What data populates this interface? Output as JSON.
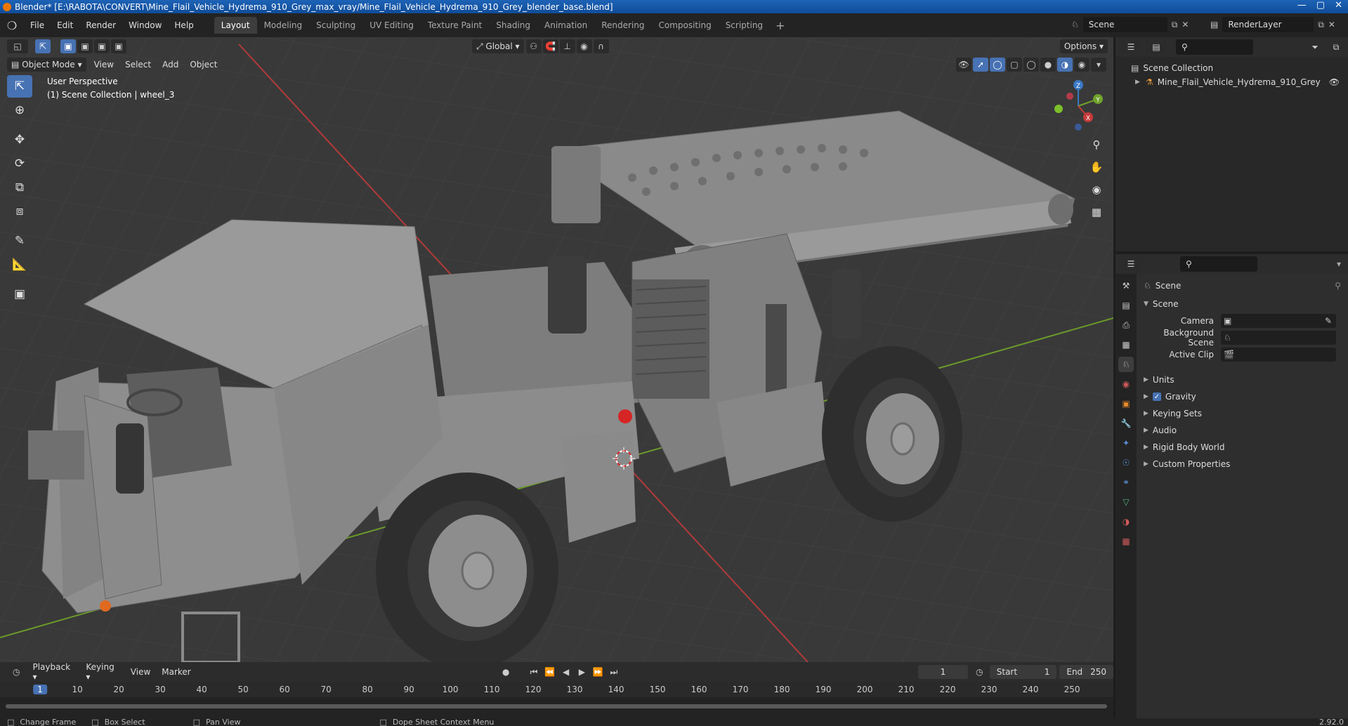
{
  "window": {
    "title": "Blender* [E:\\RABOTA\\CONVERT\\Mine_Flail_Vehicle_Hydrema_910_Grey_max_vray/Mine_Flail_Vehicle_Hydrema_910_Grey_blender_base.blend]"
  },
  "menu": [
    "File",
    "Edit",
    "Render",
    "Window",
    "Help"
  ],
  "workspaces": [
    "Layout",
    "Modeling",
    "Sculpting",
    "UV Editing",
    "Texture Paint",
    "Shading",
    "Animation",
    "Rendering",
    "Compositing",
    "Scripting"
  ],
  "active_workspace": "Layout",
  "scene_name": "Scene",
  "render_layer": "RenderLayer",
  "viewport": {
    "transform_orientation": "Global",
    "options_label": "Options",
    "mode": "Object Mode",
    "menus": [
      "View",
      "Select",
      "Add",
      "Object"
    ],
    "info_line1": "User Perspective",
    "info_line2": "(1) Scene Collection | wheel_3",
    "gizmo_axes": {
      "x": "X",
      "y": "Y",
      "z": "Z"
    },
    "colors": {
      "x_axis": "#c63a3a",
      "y_axis": "#6fa22b",
      "z_axis": "#3a78c6",
      "accent": "#4772b3"
    }
  },
  "timeline": {
    "menus": [
      "Playback",
      "Keying",
      "View",
      "Marker"
    ],
    "current_frame": "1",
    "start_label": "Start",
    "start": "1",
    "end_label": "End",
    "end": "250",
    "ticks": [
      "1",
      "10",
      "20",
      "30",
      "40",
      "50",
      "60",
      "70",
      "80",
      "90",
      "100",
      "110",
      "120",
      "130",
      "140",
      "150",
      "160",
      "170",
      "180",
      "190",
      "200",
      "210",
      "220",
      "230",
      "240",
      "250"
    ]
  },
  "statusbar": {
    "items": [
      "Change Frame",
      "Box Select",
      "Pan View",
      "Dope Sheet Context Menu"
    ],
    "version": "2.92.0"
  },
  "outliner": {
    "root": "Scene Collection",
    "items": [
      "Mine_Flail_Vehicle_Hydrema_910_Grey"
    ]
  },
  "properties": {
    "context": "Scene",
    "panel_title": "Scene",
    "fields": [
      {
        "label": "Camera",
        "value": ""
      },
      {
        "label": "Background Scene",
        "value": ""
      },
      {
        "label": "Active Clip",
        "value": ""
      }
    ],
    "sections": [
      "Units",
      "Gravity",
      "Keying Sets",
      "Audio",
      "Rigid Body World",
      "Custom Properties"
    ],
    "gravity_checked": true
  }
}
